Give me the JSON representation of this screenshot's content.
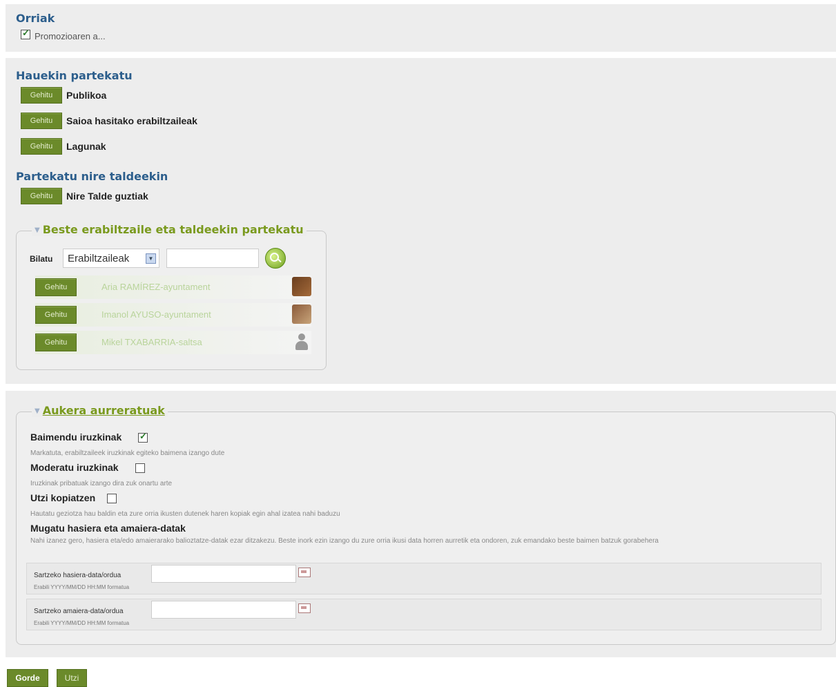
{
  "pages": {
    "title": "Orriak",
    "item": "Promozioaren a..."
  },
  "share_with": {
    "title": "Hauekin partekatu",
    "add_label": "Gehitu",
    "options": [
      "Publikoa",
      "Saioa hasitako erabiltzaileak",
      "Lagunak"
    ]
  },
  "share_groups": {
    "title": "Partekatu nire taldeekin",
    "options": [
      "Nire Talde guztiak"
    ]
  },
  "other_share": {
    "legend": "Beste erabiltzaile eta taldeekin partekatu",
    "search_label": "Bilatu",
    "search_type": "Erabiltzaileak",
    "search_value": "",
    "results": [
      {
        "name": "Aria RAMÍREZ-ayuntament",
        "avatar": "avatar-photo-1"
      },
      {
        "name": "Imanol AYUSO-ayuntament",
        "avatar": "avatar-photo-2"
      },
      {
        "name": "Mikel TXABARRIA-saltsa",
        "avatar": "avatar-default"
      }
    ]
  },
  "advanced": {
    "legend": "Aukera aurreratuak",
    "allow_comments": {
      "label": "Baimendu iruzkinak",
      "checked": true,
      "desc": "Markatuta, erabiltzaileek iruzkinak egiteko baimena izango dute"
    },
    "moderate_comments": {
      "label": "Moderatu iruzkinak",
      "checked": false,
      "desc": "Iruzkinak pribatuak izango dira zuk onartu arte"
    },
    "allow_copy": {
      "label": "Utzi kopiatzen",
      "checked": false,
      "desc": "Hautatu geziotza hau baldin eta zure orria ikusten dutenek haren kopiak egin ahal izatea nahi baduzu"
    },
    "date_limits": {
      "label": "Mugatu hasiera eta amaiera-datak",
      "desc": "Nahi izanez gero, hasiera eta/edo amaierarako balioztatze-datak ezar ditzakezu. Beste inork ezin izango du zure orria ikusi data horren aurretik eta ondoren, zuk emandako beste baimen batzuk gorabehera",
      "start_label": "Sartzeko hasiera-data/ordua",
      "start_value": "",
      "end_label": "Sartzeko amaiera-data/ordua",
      "end_value": "",
      "hint": "Erabili YYYY/MM/DD HH:MM formatua"
    }
  },
  "footer": {
    "save": "Gorde",
    "cancel": "Utzi"
  }
}
